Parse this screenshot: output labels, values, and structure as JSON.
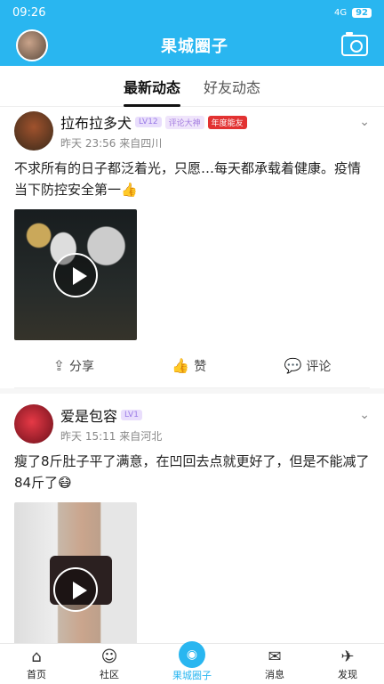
{
  "status": {
    "time": "09:26",
    "battery": "92",
    "signal": "4G"
  },
  "header": {
    "title": "果城圈子"
  },
  "tabs": [
    {
      "label": "最新动态"
    },
    {
      "label": "好友动态"
    }
  ],
  "posts": [
    {
      "username": "拉布拉多犬",
      "badges": [
        "LV12",
        "评论大神",
        "年度能友"
      ],
      "time": "昨天 23:56",
      "location": "来自四川",
      "content": "不求所有的日子都泛着光，只愿…每天都承载着健康。疫情当下防控安全第一👍"
    },
    {
      "username": "爱是包容",
      "badges": [
        "LV1"
      ],
      "time": "昨天 15:11",
      "location": "来自河北",
      "content": "瘦了8斤肚子平了满意，在凹回去点就更好了，但是不能减了84斤了😷"
    }
  ],
  "actions": {
    "share": "分享",
    "like": "赞",
    "comment": "评论"
  },
  "nav": [
    {
      "label": "首页",
      "icon": "home-icon"
    },
    {
      "label": "社区",
      "icon": "community-icon"
    },
    {
      "label": "果城圈子",
      "icon": "circle-icon"
    },
    {
      "label": "消息",
      "icon": "message-icon"
    },
    {
      "label": "发现",
      "icon": "discover-icon"
    }
  ]
}
